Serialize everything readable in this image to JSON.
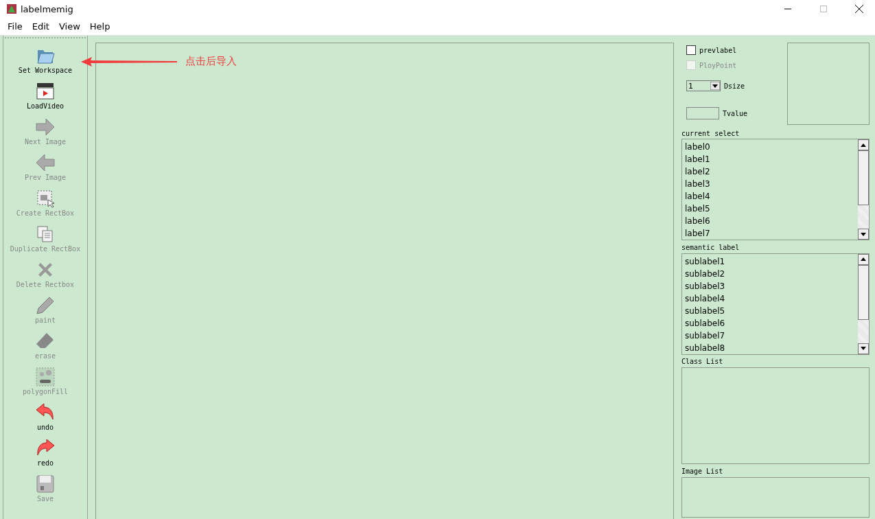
{
  "window": {
    "title": "labelmemig"
  },
  "menu": [
    "File",
    "Edit",
    "View",
    "Help"
  ],
  "tools": [
    {
      "kind": "folder",
      "label": "Set Workspace",
      "disabled": false
    },
    {
      "kind": "video",
      "label": "LoadVideo",
      "disabled": false
    },
    {
      "kind": "next",
      "label": "Next Image",
      "disabled": true
    },
    {
      "kind": "prev",
      "label": "Prev Image",
      "disabled": true
    },
    {
      "kind": "rect",
      "label": "Create RectBox",
      "disabled": true
    },
    {
      "kind": "duplicate",
      "label": "Duplicate RectBox",
      "disabled": true
    },
    {
      "kind": "delete",
      "label": "Delete Rectbox",
      "disabled": true
    },
    {
      "kind": "paint",
      "label": "paint",
      "disabled": true
    },
    {
      "kind": "erase",
      "label": "erase",
      "disabled": true
    },
    {
      "kind": "fill",
      "label": "polygonFill",
      "disabled": true
    },
    {
      "kind": "undo",
      "label": "undo",
      "disabled": false
    },
    {
      "kind": "redo",
      "label": "redo",
      "disabled": false
    },
    {
      "kind": "save",
      "label": "Save",
      "disabled": true
    }
  ],
  "annotation": {
    "text": "点击后导入"
  },
  "options": {
    "prevlabel": {
      "label": "prevlabel",
      "checked": false,
      "disabled": false
    },
    "ploypoint": {
      "label": "PloyPoint",
      "checked": false,
      "disabled": true
    },
    "dsize": {
      "value": "1",
      "label": "Dsize"
    },
    "tvalue": {
      "label": "Tvalue"
    }
  },
  "current_select": {
    "title": "current select",
    "items": [
      "label0",
      "label1",
      "label2",
      "label3",
      "label4",
      "label5",
      "label6",
      "label7"
    ]
  },
  "semantic_label": {
    "title": "semantic label",
    "items": [
      "sublabel1",
      "sublabel2",
      "sublabel3",
      "sublabel4",
      "sublabel5",
      "sublabel6",
      "sublabel7",
      "sublabel8"
    ]
  },
  "class_list": {
    "title": "Class List"
  },
  "image_list": {
    "title": "Image List"
  }
}
